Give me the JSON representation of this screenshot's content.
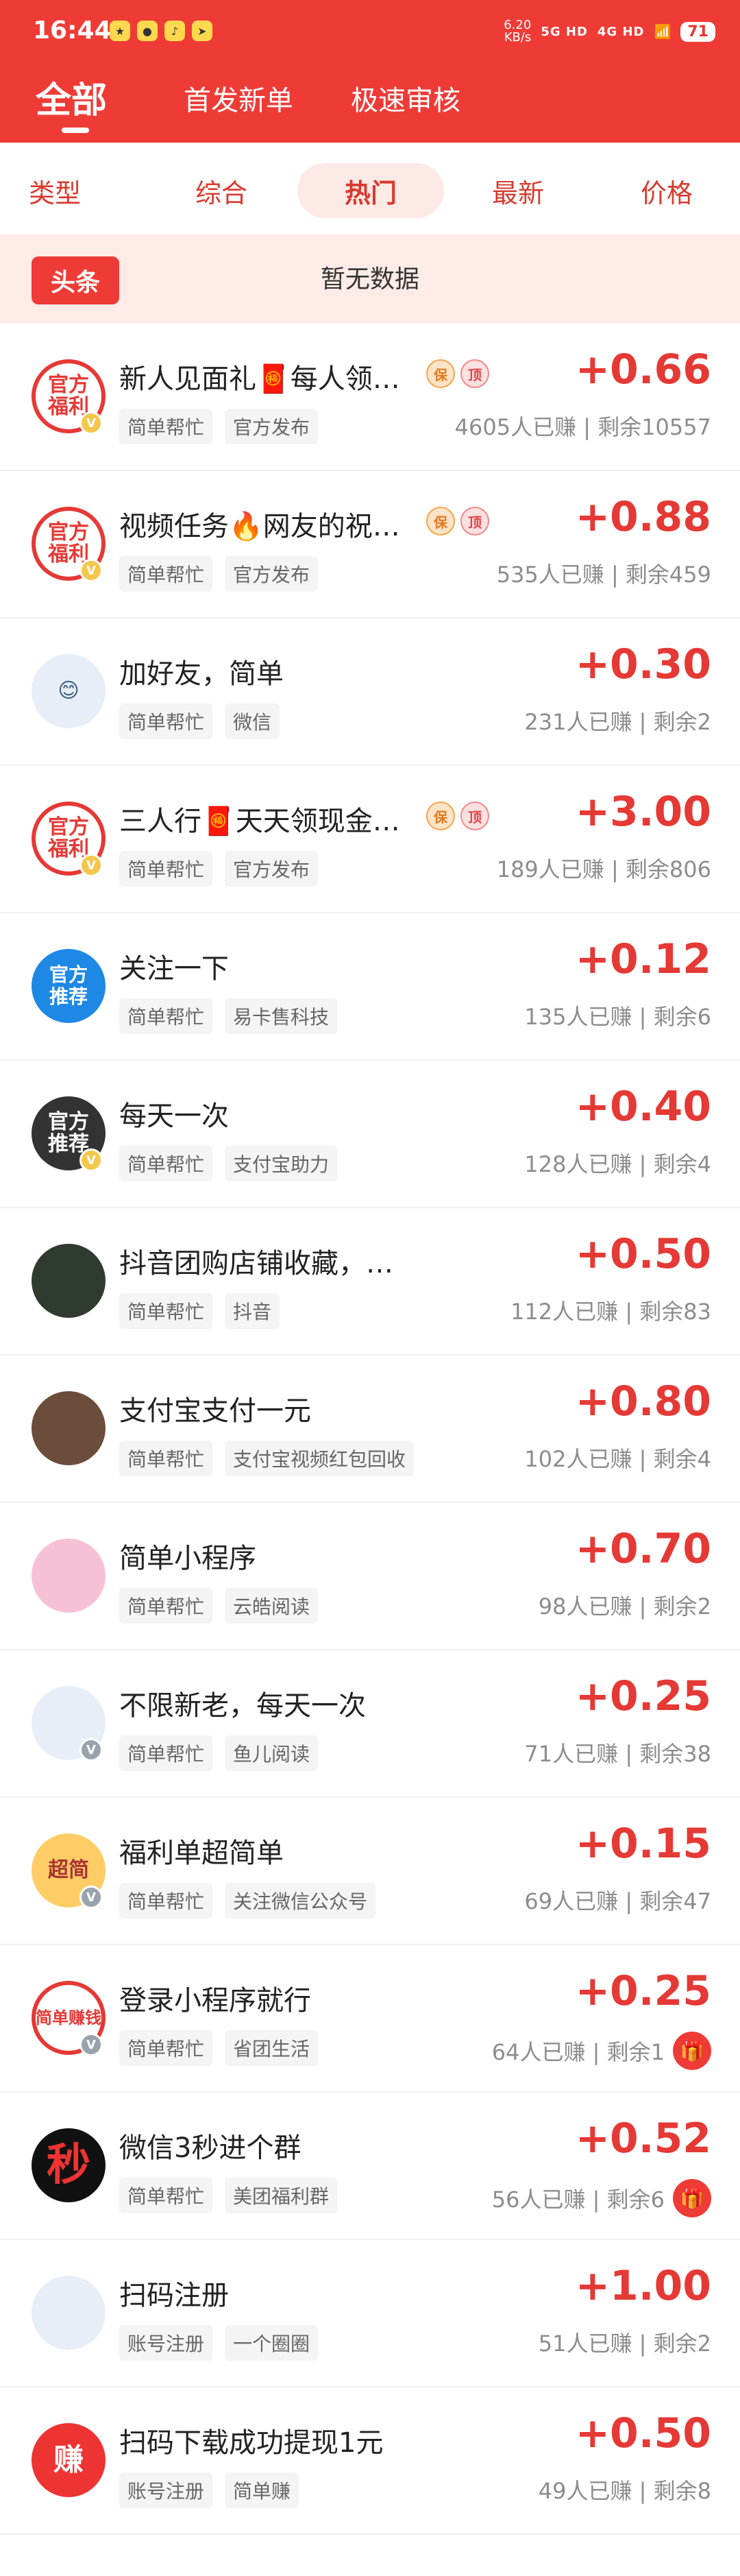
{
  "status": {
    "time": "16:44",
    "speed_value": "6.20",
    "speed_unit": "KB/s",
    "signal1": "5G HD",
    "signal2": "4G HD",
    "battery": "71"
  },
  "top_tabs": {
    "all": "全部",
    "first": "首发新单",
    "fast": "极速审核"
  },
  "filters": [
    "类型",
    "综合",
    "热门",
    "最新",
    "价格"
  ],
  "headline": {
    "label": "头条",
    "text": "暂无数据"
  },
  "items": [
    {
      "avatar_text": "官方\n福利",
      "title": "新人见面礼🧧每人领…",
      "reward": "+0.66",
      "tags": [
        "简单帮忙",
        "官方发布"
      ],
      "stats": "4605人已赚 | 剩余10557"
    },
    {
      "avatar_text": "官方\n福利",
      "title": "视频任务🔥网友的祝…",
      "reward": "+0.88",
      "tags": [
        "简单帮忙",
        "官方发布"
      ],
      "stats": "535人已赚 | 剩余459"
    },
    {
      "avatar_text": "😊",
      "title": "加好友，简单",
      "reward": "+0.30",
      "tags": [
        "简单帮忙",
        "微信"
      ],
      "stats": "231人已赚 | 剩余2"
    },
    {
      "avatar_text": "官方\n福利",
      "title": "三人行🧧天天领现金…",
      "reward": "+3.00",
      "tags": [
        "简单帮忙",
        "官方发布"
      ],
      "stats": "189人已赚 | 剩余806"
    },
    {
      "avatar_text": "官方\n推荐",
      "title": "关注一下",
      "reward": "+0.12",
      "tags": [
        "简单帮忙",
        "易卡售科技"
      ],
      "stats": "135人已赚 | 剩余6"
    },
    {
      "avatar_text": "官方\n推荐",
      "title": "每天一次",
      "reward": "+0.40",
      "tags": [
        "简单帮忙",
        "支付宝助力"
      ],
      "stats": "128人已赚 | 剩余4"
    },
    {
      "avatar_text": "",
      "title": "抖音团购店铺收藏，…",
      "reward": "+0.50",
      "tags": [
        "简单帮忙",
        "抖音"
      ],
      "stats": "112人已赚 | 剩余83"
    },
    {
      "avatar_text": "",
      "title": "支付宝支付一元",
      "reward": "+0.80",
      "tags": [
        "简单帮忙",
        "支付宝视频红包回收"
      ],
      "stats": "102人已赚 | 剩余4"
    },
    {
      "avatar_text": "",
      "title": "简单小程序",
      "reward": "+0.70",
      "tags": [
        "简单帮忙",
        "云皓阅读"
      ],
      "stats": "98人已赚 | 剩余2"
    },
    {
      "avatar_text": "",
      "title": "不限新老，每天一次",
      "reward": "+0.25",
      "tags": [
        "简单帮忙",
        "鱼儿阅读"
      ],
      "stats": "71人已赚 | 剩余38"
    },
    {
      "avatar_text": "超简",
      "title": "福利单超简单",
      "reward": "+0.15",
      "tags": [
        "简单帮忙",
        "关注微信公众号"
      ],
      "stats": "69人已赚 | 剩余47"
    },
    {
      "avatar_text": "简单赚钱",
      "title": "登录小程序就行",
      "reward": "+0.25",
      "tags": [
        "简单帮忙",
        "省团生活"
      ],
      "stats": "64人已赚 | 剩余1"
    },
    {
      "avatar_text": "秒",
      "title": "微信3秒进个群",
      "reward": "+0.52",
      "tags": [
        "简单帮忙",
        "美团福利群"
      ],
      "stats": "56人已赚 | 剩余6"
    },
    {
      "avatar_text": "",
      "title": "扫码注册",
      "reward": "+1.00",
      "tags": [
        "账号注册",
        "一个圈圈"
      ],
      "stats": "51人已赚 | 剩余2"
    },
    {
      "avatar_text": "赚",
      "title": "扫码下载成功提现1元",
      "reward": "+0.50",
      "tags": [
        "账号注册",
        "简单赚"
      ],
      "stats": "49人已赚 | 剩余8"
    }
  ],
  "icons": {
    "gift": "🎁",
    "verified": "V"
  }
}
